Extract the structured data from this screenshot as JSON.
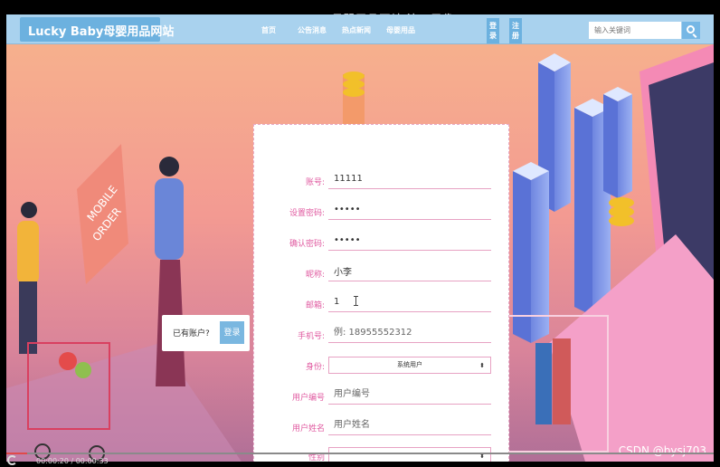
{
  "video": {
    "title": "PHP Lucky Baby母婴用品网站 演示录像.mp4",
    "timecode": "00:00:20 / 00:00:33",
    "progress": 0.03,
    "watermark": "CSDN @bysj703"
  },
  "header": {
    "logo": "Lucky Baby母婴用品网站",
    "nav": [
      "首页",
      "公告消息",
      "热点新闻",
      "母婴用品"
    ],
    "login_label": "登录",
    "register_label": "注册",
    "search_placeholder": "输入关键词"
  },
  "login_prompt": {
    "text": "已有账户?",
    "button": "登录"
  },
  "form": {
    "fields": [
      {
        "label": "账号:",
        "value": "11111",
        "placeholder": ""
      },
      {
        "label": "设置密码:",
        "value": "•••••",
        "placeholder": ""
      },
      {
        "label": "确认密码:",
        "value": "•••••",
        "placeholder": ""
      },
      {
        "label": "昵称:",
        "value": "小李",
        "placeholder": ""
      },
      {
        "label": "邮箱:",
        "value": "1",
        "placeholder": ""
      },
      {
        "label": "手机号:",
        "value": "",
        "placeholder": "例: 18955552312"
      },
      {
        "label": "身份:",
        "select": "系统用户"
      },
      {
        "label": "用户编号",
        "value": "",
        "placeholder": "用户编号"
      },
      {
        "label": "用户姓名",
        "value": "",
        "placeholder": "用户姓名"
      },
      {
        "label": "性别",
        "select": ""
      }
    ]
  },
  "colors": {
    "accent": "#6cb1df",
    "label": "#e05aa0",
    "underline": "#e7a2c3"
  }
}
